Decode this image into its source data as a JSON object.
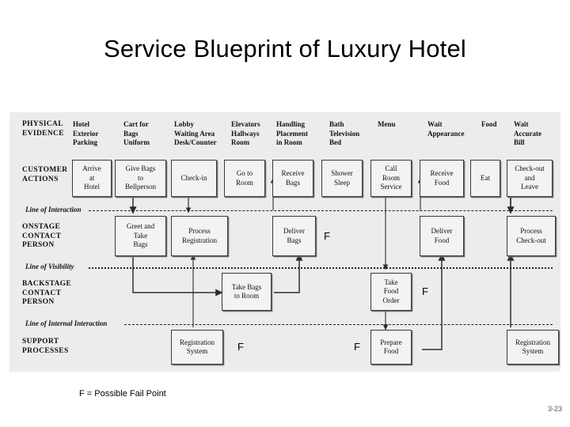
{
  "slide": {
    "title": "Service Blueprint of Luxury Hotel",
    "legend": "F = Possible Fail Point",
    "page_number": "3-23"
  },
  "colors": {
    "panel_background": "#ececec",
    "node_border": "#3a3a3a",
    "node_fill": "#f3f3f3",
    "text": "#111111",
    "connector": "#444444"
  },
  "rows": {
    "physical_evidence": {
      "label": "PHYSICAL\nEVIDENCE"
    },
    "customer_actions": {
      "label": "CUSTOMER\nACTIONS"
    },
    "onstage": {
      "label": "ONSTAGE\nCONTACT\nPERSON"
    },
    "backstage": {
      "label": "BACKSTAGE\nCONTACT\nPERSON"
    },
    "support": {
      "label": "SUPPORT\nPROCESSES"
    }
  },
  "lines": {
    "interaction": "Line of Interaction",
    "visibility": "Line of Visibility",
    "internal_interaction": "Line of Internal Interaction"
  },
  "physical_evidence": [
    {
      "text": "Hotel\nExterior\nParking"
    },
    {
      "text": "Cart for\nBags\nUniform"
    },
    {
      "text": "Lobby\nWaiting Area\nDesk/Counter"
    },
    {
      "text": "Elevators\nHallways\nRoom"
    },
    {
      "text": "Handling\nPlacement\nin Room"
    },
    {
      "text": "Bath\nTelevision\nBed"
    },
    {
      "text": "Menu"
    },
    {
      "text": "Wait\nAppearance"
    },
    {
      "text": "Food"
    },
    {
      "text": "Wait\nAccurate\nBill"
    }
  ],
  "customer_actions": [
    {
      "text": "Arrive\nat\nHotel"
    },
    {
      "text": "Give Bags\nto\nBellperson"
    },
    {
      "text": "Check-in"
    },
    {
      "text": "Go to\nRoom"
    },
    {
      "text": "Receive\nBags"
    },
    {
      "text": "Shower\nSleep"
    },
    {
      "text": "Call\nRoom\nService"
    },
    {
      "text": "Receive\nFood"
    },
    {
      "text": "Eat"
    },
    {
      "text": "Check-out\nand\nLeave"
    }
  ],
  "onstage_actions": [
    {
      "text": "Greet and\nTake\nBags"
    },
    {
      "text": "Process\nRegistration"
    },
    {
      "text": "Deliver\nBags"
    },
    {
      "text": "Deliver\nFood"
    },
    {
      "text": "Process\nCheck-out"
    }
  ],
  "backstage_actions": [
    {
      "text": "Take Bags\nto Room"
    },
    {
      "text": "Take\nFood\nOrder"
    }
  ],
  "support_processes": [
    {
      "text": "Registration\nSystem"
    },
    {
      "text": "Prepare\nFood"
    },
    {
      "text": "Registration\nSystem"
    }
  ],
  "fail_points": [
    {
      "marker": "F",
      "near": "deliver-bags"
    },
    {
      "marker": "F",
      "near": "take-food-order"
    },
    {
      "marker": "F",
      "near": "registration-system-left"
    },
    {
      "marker": "F",
      "near": "prepare-food"
    }
  ]
}
